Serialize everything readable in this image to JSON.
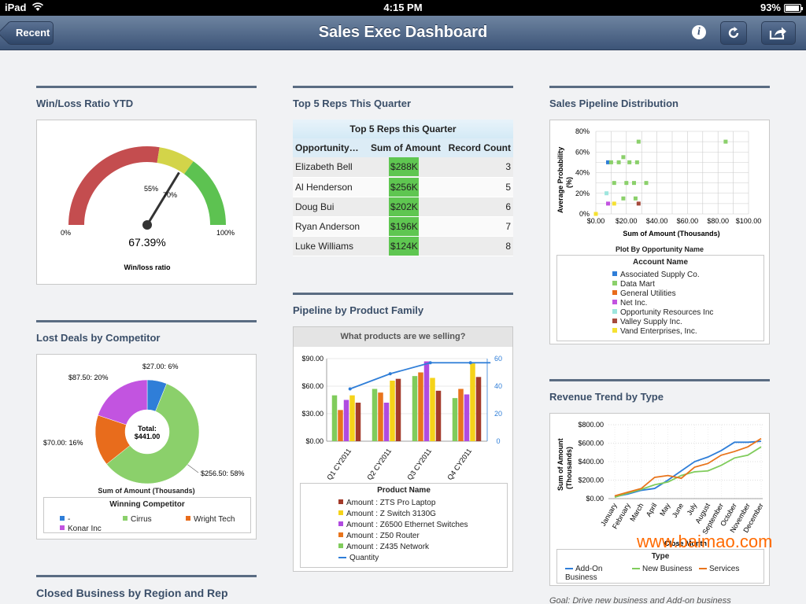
{
  "status_bar": {
    "carrier": "iPad",
    "time": "4:15 PM",
    "battery": "93%",
    "battery_level": 0.93
  },
  "nav": {
    "back_label": "Recent",
    "title": "Sales Exec Dashboard",
    "icons": [
      "info-icon",
      "refresh-icon",
      "share-icon"
    ]
  },
  "colors": {
    "nav": "#3c5478",
    "rule": "#5a6c82",
    "heading": "#3b4f69",
    "gauge_red": "#c44d4f",
    "gauge_yellow": "#d3d449",
    "gauge_green": "#5dc251",
    "amount_green": "#5fc651"
  },
  "winloss": {
    "heading": "Win/Loss Ratio YTD",
    "value": "67.39%",
    "caption": "Win/loss ratio",
    "labels": {
      "min": "0%",
      "max": "100%",
      "t1": "55%",
      "t2": "70%"
    },
    "chart_data": {
      "type": "gauge",
      "value": 67.39,
      "min": 0,
      "max": 100,
      "bands": [
        {
          "from": 0,
          "to": 55,
          "color": "#c44d4f"
        },
        {
          "from": 55,
          "to": 70,
          "color": "#d3d449"
        },
        {
          "from": 70,
          "to": 100,
          "color": "#5dc251"
        }
      ]
    }
  },
  "topreps": {
    "heading": "Top 5 Reps This Quarter",
    "table_title": "Top 5 Reps this Quarter",
    "columns": [
      "Opportunity…",
      "Sum of Amount",
      "Record Count"
    ],
    "rows": [
      {
        "name": "Elizabeth Bell",
        "amount": "$288K",
        "count": "3"
      },
      {
        "name": "Al Henderson",
        "amount": "$256K",
        "count": "5"
      },
      {
        "name": "Doug Bui",
        "amount": "$202K",
        "count": "6"
      },
      {
        "name": "Ryan Anderson",
        "amount": "$196K",
        "count": "7"
      },
      {
        "name": "Luke Williams",
        "amount": "$124K",
        "count": "8"
      }
    ]
  },
  "pipeline_dist": {
    "heading": "Sales Pipeline Distribution",
    "ylabel1": "Average Probability",
    "ylabel2": "(%)",
    "xlabel": "Sum of Amount (Thousands)",
    "plot_by": "Plot By Opportunity Name",
    "legend_title": "Account Name",
    "legend": [
      {
        "name": "Associated Supply Co.",
        "color": "#2f7ed8"
      },
      {
        "name": "Data Mart",
        "color": "#8bd06b"
      },
      {
        "name": "General Utilities",
        "color": "#e86c1c"
      },
      {
        "name": "Net Inc.",
        "color": "#c254e0"
      },
      {
        "name": "Opportunity Resources Inc",
        "color": "#9ee6de"
      },
      {
        "name": "Valley Supply Inc.",
        "color": "#a64a3c"
      },
      {
        "name": "Vand Enterprises, Inc.",
        "color": "#f5e132"
      }
    ],
    "chart_data": {
      "type": "scatter",
      "xlim": [
        0,
        100
      ],
      "ylim": [
        0,
        80
      ],
      "xticks": [
        "$0.00",
        "$20.00",
        "$40.00",
        "$60.00",
        "$80.00",
        "$100.00"
      ],
      "yticks": [
        "0%",
        "20%",
        "40%",
        "60%",
        "80%"
      ],
      "points": [
        {
          "x": 0,
          "y": 0,
          "series": "Vand Enterprises, Inc."
        },
        {
          "x": 8,
          "y": 50,
          "series": "Associated Supply Co."
        },
        {
          "x": 10,
          "y": 50,
          "series": "Data Mart"
        },
        {
          "x": 15,
          "y": 50,
          "series": "Data Mart"
        },
        {
          "x": 18,
          "y": 55,
          "series": "Data Mart"
        },
        {
          "x": 22,
          "y": 50,
          "series": "Data Mart"
        },
        {
          "x": 27,
          "y": 50,
          "series": "Data Mart"
        },
        {
          "x": 28,
          "y": 70,
          "series": "Data Mart"
        },
        {
          "x": 12,
          "y": 30,
          "series": "Data Mart"
        },
        {
          "x": 20,
          "y": 30,
          "series": "Data Mart"
        },
        {
          "x": 25,
          "y": 30,
          "series": "Data Mart"
        },
        {
          "x": 33,
          "y": 30,
          "series": "Data Mart"
        },
        {
          "x": 18,
          "y": 15,
          "series": "Data Mart"
        },
        {
          "x": 26,
          "y": 15,
          "series": "Data Mart"
        },
        {
          "x": 85,
          "y": 70,
          "series": "Data Mart"
        },
        {
          "x": 7,
          "y": 20,
          "series": "Opportunity Resources Inc"
        },
        {
          "x": 8,
          "y": 10,
          "series": "Net Inc."
        },
        {
          "x": 12,
          "y": 10,
          "series": "Vand Enterprises, Inc."
        },
        {
          "x": 28,
          "y": 10,
          "series": "Valley Supply Inc."
        }
      ]
    }
  },
  "lost_deals": {
    "heading": "Lost Deals by Competitor",
    "center1": "Total:",
    "center2": "$441.00",
    "axis_title": "Sum of Amount (Thousands)",
    "legend_title": "Winning Competitor",
    "labels": {
      "l1": "$27.00: 6%",
      "l2": "$256.50: 58%",
      "l3": "$70.00: 16%",
      "l4": "$87.50: 20%"
    },
    "legend": [
      {
        "name": "-",
        "color": "#2f7ed8"
      },
      {
        "name": "Cirrus",
        "color": "#8bd06b"
      },
      {
        "name": "Wright Tech",
        "color": "#e86c1c"
      },
      {
        "name": "Konar Inc",
        "color": "#c254e0"
      }
    ],
    "chart_data": {
      "type": "pie",
      "slices": [
        {
          "name": "-",
          "value": 27.0,
          "percent": 6,
          "color": "#2f7ed8"
        },
        {
          "name": "Cirrus",
          "value": 256.5,
          "percent": 58,
          "color": "#8bd06b"
        },
        {
          "name": "Wright Tech",
          "value": 70.0,
          "percent": 16,
          "color": "#e86c1c"
        },
        {
          "name": "Konar Inc",
          "value": 87.5,
          "percent": 20,
          "color": "#c254e0"
        }
      ]
    }
  },
  "pipeline_product": {
    "heading": "Pipeline by Product Family",
    "chart_title": "What products are we selling?",
    "xlabel": "Product Name",
    "yticks_left": [
      "$0.00",
      "$30.00",
      "$60.00",
      "$90.00"
    ],
    "yticks_right": [
      "0",
      "20",
      "40",
      "60"
    ],
    "legend": [
      {
        "name": "Amount : ZTS Pro Laptop",
        "color": "#a33a2a"
      },
      {
        "name": "Amount : Z Switch 3130G",
        "color": "#f5d31a"
      },
      {
        "name": "Amount : Z6500 Ethernet Switches",
        "color": "#b04be0"
      },
      {
        "name": "Amount : Z50 Router",
        "color": "#e8741c"
      },
      {
        "name": "Amount : Z435 Network",
        "color": "#80cc5c"
      },
      {
        "name": "Quantity",
        "color": "#2f7ed8"
      }
    ],
    "chart_data": {
      "type": "bar",
      "categories": [
        "Q1 CY2011",
        "Q2 CY2011",
        "Q3 CY2011",
        "Q4 CY2011"
      ],
      "ylim": [
        0,
        90
      ],
      "y2lim": [
        0,
        60
      ],
      "series": [
        {
          "name": "Amount : Z435 Network",
          "values": [
            50,
            57,
            71,
            47
          ]
        },
        {
          "name": "Amount : Z50 Router",
          "values": [
            34,
            53,
            75,
            57
          ]
        },
        {
          "name": "Amount : Z6500 Ethernet Switches",
          "values": [
            45,
            42,
            87,
            51
          ]
        },
        {
          "name": "Amount : Z Switch 3130G",
          "values": [
            50,
            66,
            69,
            85
          ]
        },
        {
          "name": "Amount : ZTS Pro Laptop",
          "values": [
            42,
            68,
            55,
            70
          ]
        }
      ],
      "line": {
        "name": "Quantity",
        "values": [
          38,
          49,
          57,
          57
        ]
      }
    }
  },
  "revenue": {
    "heading": "Revenue Trend by Type",
    "ylabel1": "Sum of Amount",
    "ylabel2": "(Thousands)",
    "xlabel": "Close Month",
    "legend_title": "Type",
    "legend": [
      {
        "name": "Add-On Business",
        "color": "#2f7ed8"
      },
      {
        "name": "New Business",
        "color": "#80cc5c"
      },
      {
        "name": "Services",
        "color": "#e8741c"
      }
    ],
    "goal": "Goal: Drive new business and Add-on business",
    "chart_data": {
      "type": "line",
      "x": [
        "January",
        "February",
        "March",
        "April",
        "May",
        "June",
        "July",
        "August",
        "September",
        "October",
        "November",
        "December"
      ],
      "ylim": [
        0,
        800
      ],
      "yticks": [
        "$0.00",
        "$200.00",
        "$400.00",
        "$600.00",
        "$800.00"
      ],
      "series": [
        {
          "name": "Add-On Business",
          "values": [
            20,
            50,
            90,
            110,
            200,
            300,
            400,
            450,
            520,
            610,
            610,
            620
          ]
        },
        {
          "name": "New Business",
          "values": [
            15,
            60,
            100,
            150,
            180,
            250,
            290,
            300,
            360,
            440,
            470,
            560
          ]
        },
        {
          "name": "Services",
          "values": [
            30,
            70,
            110,
            230,
            250,
            220,
            340,
            380,
            470,
            510,
            560,
            650
          ]
        }
      ]
    }
  },
  "closed_business": {
    "heading": "Closed Business by Region and Rep"
  },
  "watermark": "www.baimao.com"
}
